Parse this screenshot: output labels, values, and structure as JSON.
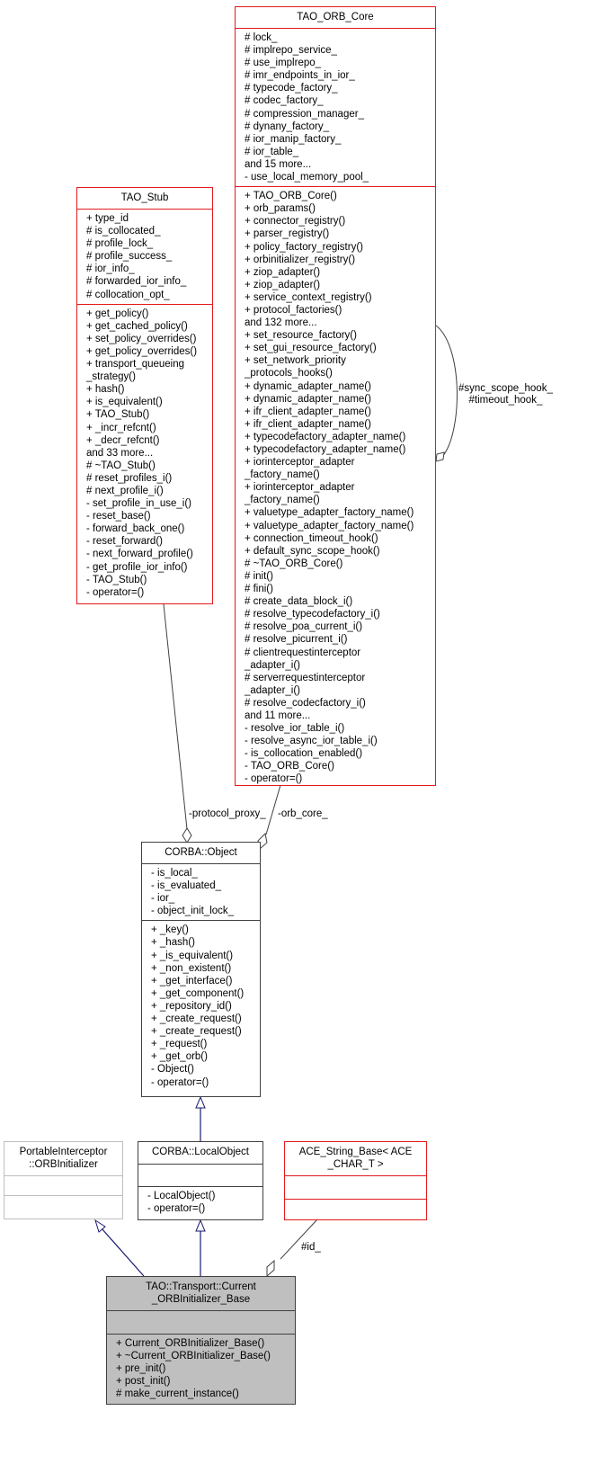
{
  "classes": {
    "tao_orb_core": {
      "name": "TAO_ORB_Core",
      "attributes": [
        "# lock_",
        "# implrepo_service_",
        "# use_implrepo_",
        "# imr_endpoints_in_ior_",
        "# typecode_factory_",
        "# codec_factory_",
        "# compression_manager_",
        "# dynany_factory_",
        "# ior_manip_factory_",
        "# ior_table_",
        "and 15 more...",
        "- use_local_memory_pool_"
      ],
      "methods": [
        "+ TAO_ORB_Core()",
        "+ orb_params()",
        "+ connector_registry()",
        "+ parser_registry()",
        "+ policy_factory_registry()",
        "+ orbinitializer_registry()",
        "+ ziop_adapter()",
        "+ ziop_adapter()",
        "+ service_context_registry()",
        "+ protocol_factories()",
        "and 132 more...",
        "+ set_resource_factory()",
        "+ set_gui_resource_factory()",
        "+ set_network_priority",
        "_protocols_hooks()",
        "+ dynamic_adapter_name()",
        "+ dynamic_adapter_name()",
        "+ ifr_client_adapter_name()",
        "+ ifr_client_adapter_name()",
        "+ typecodefactory_adapter_name()",
        "+ typecodefactory_adapter_name()",
        "+ iorinterceptor_adapter",
        "_factory_name()",
        "+ iorinterceptor_adapter",
        "_factory_name()",
        "+ valuetype_adapter_factory_name()",
        "+ valuetype_adapter_factory_name()",
        "+ connection_timeout_hook()",
        "+ default_sync_scope_hook()",
        "# ~TAO_ORB_Core()",
        "# init()",
        "# fini()",
        "# create_data_block_i()",
        "# resolve_typecodefactory_i()",
        "# resolve_poa_current_i()",
        "# resolve_picurrent_i()",
        "# clientrequestinterceptor",
        "_adapter_i()",
        "# serverrequestinterceptor",
        "_adapter_i()",
        "# resolve_codecfactory_i()",
        "and 11 more...",
        "- resolve_ior_table_i()",
        "- resolve_async_ior_table_i()",
        "- is_collocation_enabled()",
        "- TAO_ORB_Core()",
        "- operator=()"
      ]
    },
    "tao_stub": {
      "name": "TAO_Stub",
      "attributes": [
        "+ type_id",
        "# is_collocated_",
        "# profile_lock_",
        "# profile_success_",
        "# ior_info_",
        "# forwarded_ior_info_",
        "# collocation_opt_"
      ],
      "methods": [
        "+ get_policy()",
        "+ get_cached_policy()",
        "+ set_policy_overrides()",
        "+ get_policy_overrides()",
        "+ transport_queueing",
        "_strategy()",
        "+ hash()",
        "+ is_equivalent()",
        "+ TAO_Stub()",
        "+ _incr_refcnt()",
        "+ _decr_refcnt()",
        "and 33 more...",
        "# ~TAO_Stub()",
        "# reset_profiles_i()",
        "# next_profile_i()",
        "- set_profile_in_use_i()",
        "- reset_base()",
        "- forward_back_one()",
        "- reset_forward()",
        "- next_forward_profile()",
        "- get_profile_ior_info()",
        "- TAO_Stub()",
        "- operator=()"
      ]
    },
    "corba_object": {
      "name": "CORBA::Object",
      "attributes": [
        "- is_local_",
        "- is_evaluated_",
        "- ior_",
        "- object_init_lock_"
      ],
      "methods": [
        "+ _key()",
        "+ _hash()",
        "+ _is_equivalent()",
        "+ _non_existent()",
        "+ _get_interface()",
        "+ _get_component()",
        "+ _repository_id()",
        "+ _create_request()",
        "+ _create_request()",
        "+ _request()",
        "+ _get_orb()",
        "- Object()",
        "- operator=()"
      ]
    },
    "orb_initializer": {
      "name": "PortableInterceptor\n::ORBInitializer",
      "attributes": [],
      "methods": []
    },
    "corba_localobject": {
      "name": "CORBA::LocalObject",
      "attributes": [],
      "methods": [
        "- LocalObject()",
        "- operator=()"
      ]
    },
    "ace_string_base": {
      "name": "ACE_String_Base< ACE\n_CHAR_T >",
      "attributes": [],
      "methods": []
    },
    "current_orbinitializer_base": {
      "name": "TAO::Transport::Current\n_ORBInitializer_Base",
      "attributes": [],
      "methods": [
        "+ Current_ORBInitializer_Base()",
        "+ ~Current_ORBInitializer_Base()",
        "+ pre_init()",
        "+ post_init()",
        "# make_current_instance()"
      ]
    }
  },
  "edges": {
    "protocol_proxy": "-protocol_proxy_",
    "orb_core": "-orb_core_",
    "self_hooks": "#sync_scope_hook_\n#timeout_hook_",
    "id": "#id_"
  },
  "colors": {
    "inheritance": "#191970",
    "association": "#404040",
    "class_border_incomplete": "#e31a1c",
    "focus_fill": "#bfbfbf"
  }
}
